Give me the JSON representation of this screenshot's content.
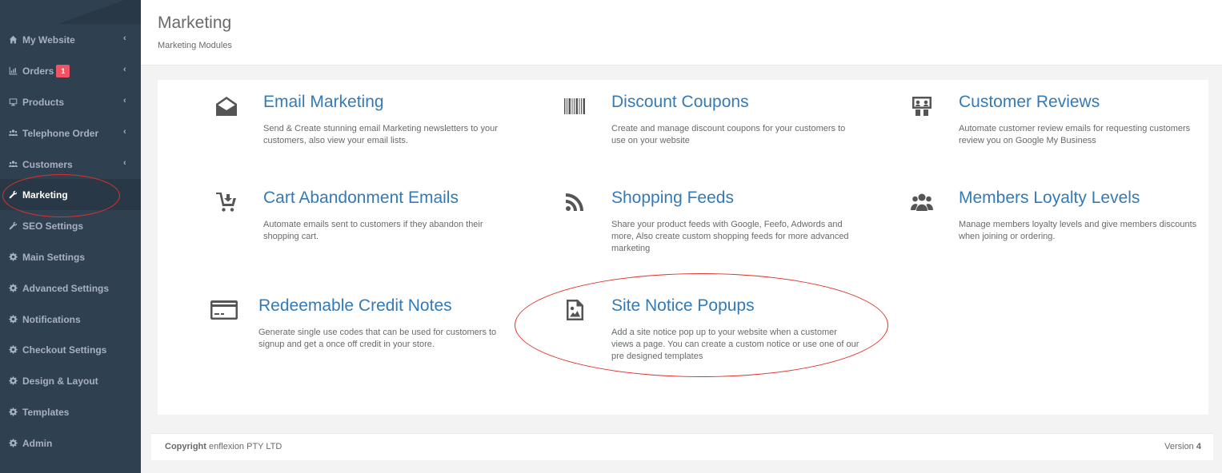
{
  "sidebar": {
    "items": [
      {
        "label": "My Website",
        "icon": "home-icon",
        "has_chevron": true
      },
      {
        "label": "Orders",
        "icon": "bar-chart-icon",
        "has_chevron": true,
        "badge": "1"
      },
      {
        "label": "Products",
        "icon": "monitor-icon",
        "has_chevron": true
      },
      {
        "label": "Telephone Order",
        "icon": "users-icon",
        "has_chevron": true
      },
      {
        "label": "Customers",
        "icon": "users-icon",
        "has_chevron": true
      },
      {
        "label": "Marketing",
        "icon": "wrench-icon",
        "active": true
      },
      {
        "label": "SEO Settings",
        "icon": "wrench-icon"
      },
      {
        "label": "Main Settings",
        "icon": "gear-icon"
      },
      {
        "label": "Advanced Settings",
        "icon": "gear-icon"
      },
      {
        "label": "Notifications",
        "icon": "gear-icon"
      },
      {
        "label": "Checkout Settings",
        "icon": "gear-icon"
      },
      {
        "label": "Design & Layout",
        "icon": "gear-icon"
      },
      {
        "label": "Templates",
        "icon": "gear-icon"
      },
      {
        "label": "Admin",
        "icon": "gear-icon"
      }
    ],
    "chevron": "‹"
  },
  "header": {
    "title": "Marketing",
    "breadcrumb": "Marketing Modules"
  },
  "modules": [
    {
      "title": "Email Marketing",
      "icon": "envelope-open-icon",
      "desc": "Send & Create stunning email Marketing newsletters to your customers, also view your email lists."
    },
    {
      "title": "Discount Coupons",
      "icon": "barcode-icon",
      "desc": "Create and manage discount coupons for your customers to use on your website"
    },
    {
      "title": "Customer Reviews",
      "icon": "review-icon",
      "desc": "Automate customer review emails for requesting customers review you on Google My Business"
    },
    {
      "title": "Cart Abandonment Emails",
      "icon": "cart-icon",
      "desc": "Automate emails sent to customers if they abandon their shopping cart."
    },
    {
      "title": "Shopping Feeds",
      "icon": "rss-icon",
      "desc": "Share your product feeds with Google, Feefo, Adwords and more, Also create custom shopping feeds for more advanced marketing"
    },
    {
      "title": "Members Loyalty Levels",
      "icon": "users-group-icon",
      "desc": "Manage members loyalty levels and give members discounts when joining or ordering."
    },
    {
      "title": "Redeemable Credit Notes",
      "icon": "credit-card-icon",
      "desc": "Generate single use codes that can be used for customers to signup and get a once off credit in your store."
    },
    {
      "title": "Site Notice Popups",
      "icon": "image-icon",
      "desc": "Add a site notice pop up to your website when a customer views a page. You can create a custom notice or use one of our pre designed templates"
    }
  ],
  "footer": {
    "copyright_label": "Copyright",
    "company": "enflexion PTY LTD",
    "version_label": "Version",
    "version": "4"
  },
  "colors": {
    "sidebar_bg": "#2f4050",
    "accent_link": "#337ab7",
    "badge": "#ed5565",
    "annotation": "#e0302a"
  }
}
